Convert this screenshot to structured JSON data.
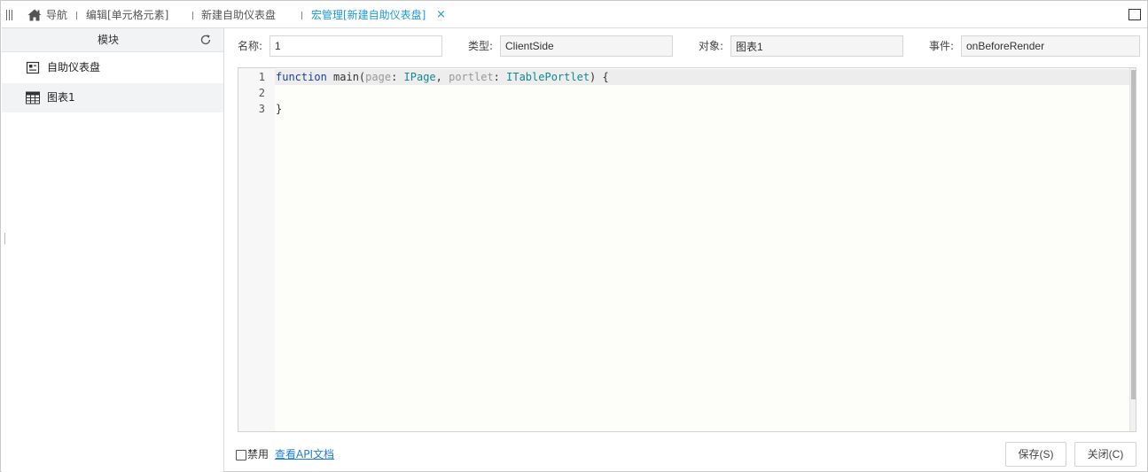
{
  "tabs": {
    "nav_label": "导航",
    "items": [
      {
        "label": "编辑[单元格元素]"
      },
      {
        "label": "新建自助仪表盘"
      },
      {
        "label": "宏管理[新建自助仪表盘]"
      }
    ],
    "close_glyph": "×"
  },
  "left_panel": {
    "title": "模块",
    "items": [
      {
        "label": "自助仪表盘",
        "icon": "dashboard-icon"
      },
      {
        "label": "图表1",
        "icon": "table-icon",
        "selected": true
      }
    ]
  },
  "form": {
    "name_label": "名称:",
    "name_value": "1",
    "type_label": "类型:",
    "type_value": "ClientSide",
    "object_label": "对象:",
    "object_value": "图表1",
    "event_label": "事件:",
    "event_value": "onBeforeRender"
  },
  "editor": {
    "line_numbers": [
      "1",
      "2",
      "3"
    ],
    "line1": {
      "kw": "function",
      "fn": " main(",
      "p1": "page",
      "c1": ": ",
      "t1": "IPage",
      "c2": ", ",
      "p2": "portlet",
      "c3": ": ",
      "t2": "ITablePortlet",
      "c4": ") {"
    },
    "line3": "}"
  },
  "footer": {
    "disable_label": "禁用",
    "api_link": "查看API文档",
    "save_button": "保存(S)",
    "close_button": "关闭(C)"
  },
  "colors": {
    "accent": "#1e9ad8",
    "keyword": "#1a3e9a",
    "type": "#12888f",
    "param": "#999999"
  }
}
